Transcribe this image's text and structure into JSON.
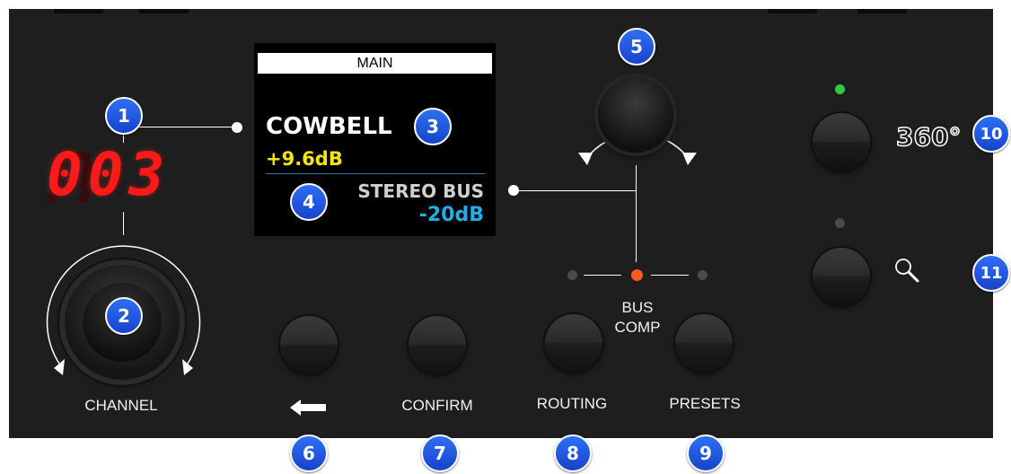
{
  "display": {
    "header": "MAIN",
    "track_name": "COWBELL",
    "track_gain": "+9.6dB",
    "bus_name": "STEREO BUS",
    "bus_gain": "-20dB",
    "name_color": "#ffffff",
    "gain_color": "#f5e50a",
    "bus_name_color": "#d0d0d0",
    "bus_gain_color": "#22aee6"
  },
  "channel": {
    "readout": "003",
    "label": "CHANNEL",
    "readout_color": "#ff1a1a"
  },
  "buttons": {
    "back_icon": "left-arrow-icon",
    "confirm": "CONFIRM",
    "routing": "ROUTING",
    "presets": "PRESETS",
    "bus_comp_line1": "BUS",
    "bus_comp_line2": "COMP",
    "view360": "360°",
    "search_icon": "magnifier-icon"
  },
  "leds": {
    "active_color": "#ff5a1f",
    "green_color": "#2ecc40",
    "off_color": "#4a4a4a"
  },
  "callouts": [
    "1",
    "2",
    "3",
    "4",
    "5",
    "6",
    "7",
    "8",
    "9",
    "10",
    "11"
  ]
}
